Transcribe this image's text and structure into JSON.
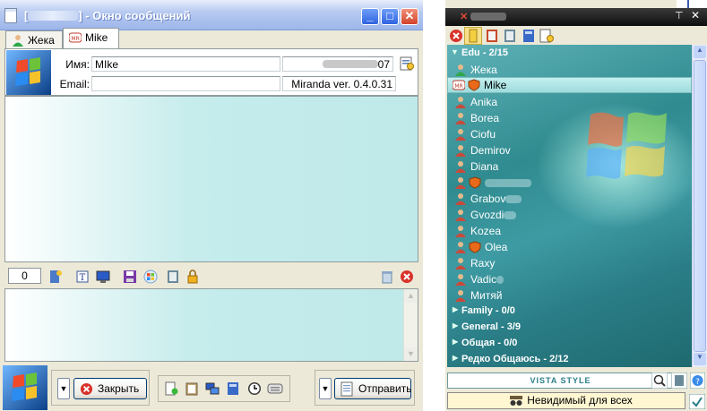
{
  "message_window": {
    "title": "- Окно сообщений",
    "tabs": [
      {
        "label": "Жека"
      },
      {
        "label": "Mike"
      }
    ],
    "info": {
      "name_label": "Имя:",
      "name_value": "MIke",
      "email_label": "Email:",
      "email_value": "",
      "uin_suffix": "07",
      "version": "Miranda ver. 0.4.0.31"
    },
    "counter": "0",
    "buttons": {
      "close": "Закрыть",
      "send": "Отправить"
    }
  },
  "contact_list": {
    "group_edu": "Edu - 2/15",
    "contacts": [
      {
        "name": "Жека",
        "status": "online"
      },
      {
        "name": "Mike",
        "status": "online",
        "selected": true
      },
      {
        "name": "Anika",
        "status": "offline"
      },
      {
        "name": "Borea",
        "status": "offline"
      },
      {
        "name": "Ciofu",
        "status": "offline"
      },
      {
        "name": "Demirov",
        "status": "offline"
      },
      {
        "name": "Diana",
        "status": "offline"
      },
      {
        "name": "",
        "status": "offline"
      },
      {
        "name": "Grabov",
        "status": "offline"
      },
      {
        "name": "Gvozdi",
        "status": "offline"
      },
      {
        "name": "Kozea",
        "status": "offline"
      },
      {
        "name": "Olea",
        "status": "offline"
      },
      {
        "name": "Raxy",
        "status": "offline"
      },
      {
        "name": "Vadic",
        "status": "offline"
      },
      {
        "name": "Митяй",
        "status": "offline"
      }
    ],
    "groups_collapsed": [
      "Family - 0/0",
      "General - 3/9",
      "Общая - 0/0",
      "Редко Общаюсь - 2/12"
    ],
    "skin_label": "VISTA STYLE",
    "status_label": "Невидимый для всех"
  }
}
